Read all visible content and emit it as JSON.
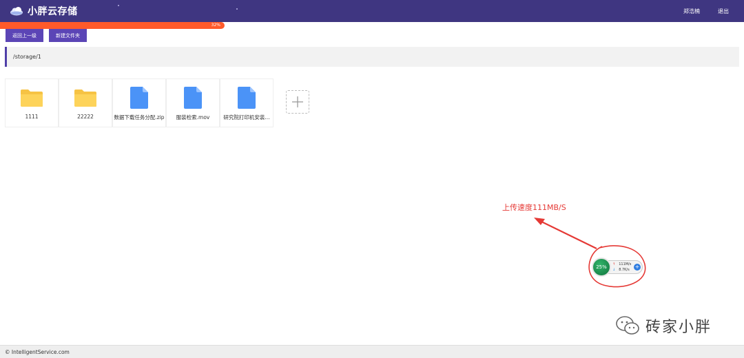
{
  "header": {
    "title": "小胖云存储",
    "user_name": "郑浩楠",
    "logout_label": "退出",
    "bg_color": "#3f3681",
    "logo_icon": "cloud-icon"
  },
  "upload_progress": {
    "percent": 32,
    "label": "32%",
    "color": "#ff5a2a"
  },
  "toolbar": {
    "back_label": "返回上一级",
    "new_folder_label": "新建文件夹",
    "button_color": "#5b45b6"
  },
  "path": {
    "current": "/storage/1"
  },
  "files": [
    {
      "name": "1111",
      "type": "folder",
      "icon": "folder-icon"
    },
    {
      "name": "22222",
      "type": "folder",
      "icon": "folder-icon"
    },
    {
      "name": "数据下载任务分配.zip",
      "type": "file",
      "icon": "file-icon"
    },
    {
      "name": "服装检索.mov",
      "type": "file",
      "icon": "file-icon"
    },
    {
      "name": "研究院打印机安装...",
      "type": "file",
      "icon": "file-icon"
    }
  ],
  "add_tile": {
    "icon": "plus-icon"
  },
  "annotation": {
    "text": "上传速度111MB/S",
    "color": "#e53935"
  },
  "speed_widget": {
    "percent_label": "25%",
    "upload_speed": "111M/s",
    "download_speed": "8.7K/s",
    "upload_arrow": "↑",
    "download_arrow": "↓"
  },
  "watermark": {
    "text": "砖家小胖",
    "icon": "wechat-icon"
  },
  "footer": {
    "text": "© IntelligentService.com"
  }
}
